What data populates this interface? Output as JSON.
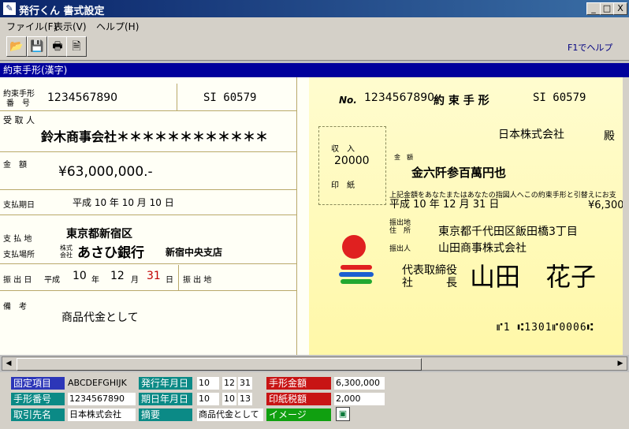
{
  "window": {
    "title": "発行くん 書式設定",
    "min": "_",
    "max": "□",
    "close": "X"
  },
  "menu": [
    "ファイル(F)",
    "表示(V)",
    "ヘルプ(H)"
  ],
  "toolbar": {
    "hint": "F1でヘルプ"
  },
  "document": {
    "title": "約束手形(漢字)"
  },
  "stub": {
    "note_no_label_1": "約束手形",
    "note_no_label_2": "番　号",
    "note_no": "1234567890",
    "code": "SI 60579",
    "payee_label": "受 取 人",
    "payee": "鈴木商事会社＊＊＊＊＊＊＊＊＊＊＊＊",
    "amount_label": "金　額",
    "amount": "¥63,000,000.-",
    "due_label": "支払期日",
    "due": "平成 10 年 10 月 10 日",
    "pay_place_label": "支 払 地",
    "pay_place": "東京都新宿区",
    "bank_label": "支払場所",
    "bank_kabu": "株式会社",
    "bank": "あさひ銀行",
    "branch": "新宿中央支店",
    "issue_label": "振 出 日",
    "issue_era": "平成",
    "issue_y": "10",
    "issue_y_unit": "年",
    "issue_m": "12",
    "issue_m_unit": "月",
    "issue_d": "31",
    "issue_d_unit": "日",
    "issue_place_label": "振 出 地",
    "remark_label": "備　考",
    "remark": "商品代金として"
  },
  "check": {
    "no_label": "No.",
    "no": "1234567890",
    "title": "約 束 手 形",
    "code": "SI 60579",
    "payee": "日本株式会社",
    "dono": "殿",
    "stamp_top": "収　入",
    "stamp_value": "20000",
    "stamp_bottom": "印　紙",
    "amount_label": "金　額",
    "amount": "金六阡参百萬円也",
    "clause": "上記金額をあなたまたはあなたの指図人へこの約束手形と引替えにお支",
    "due": "平成 10 年 12 月 31 日",
    "due_amount": "¥6,300",
    "issue_place_label": "振出地\n住　所",
    "issue_place": "東京都千代田区飯田橋3丁目",
    "issuer_label": "振出人",
    "issuer": "山田商事株式会社",
    "rep_title_1": "代表取締役",
    "rep_title_2": "社　　　長",
    "rep_name": "山田　花子",
    "micr": "⑈1 ⑆1301⑈0006⑆"
  },
  "fields": {
    "fixed_label": "固定項目",
    "fixed_value": "ABCDEFGHIJK",
    "issue_date_label": "発行年月日",
    "issue_date": [
      "10",
      "12",
      "31"
    ],
    "amount_label": "手形金額",
    "amount": "6,300,000",
    "note_no_label": "手形番号",
    "note_no": "1234567890",
    "due_date_label": "期日年月日",
    "due_date": [
      "10",
      "10",
      "13"
    ],
    "stamp_tax_label": "印紙税額",
    "stamp_tax": "2,000",
    "partner_label": "取引先名",
    "partner": "日本株式会社",
    "summary_label": "摘要",
    "summary": "商品代金として",
    "image_label": "イメージ"
  },
  "colors": {
    "label_blue": "#2c36b8",
    "label_teal": "#0b8a86",
    "label_red": "#c81414",
    "label_green": "#10a010"
  }
}
